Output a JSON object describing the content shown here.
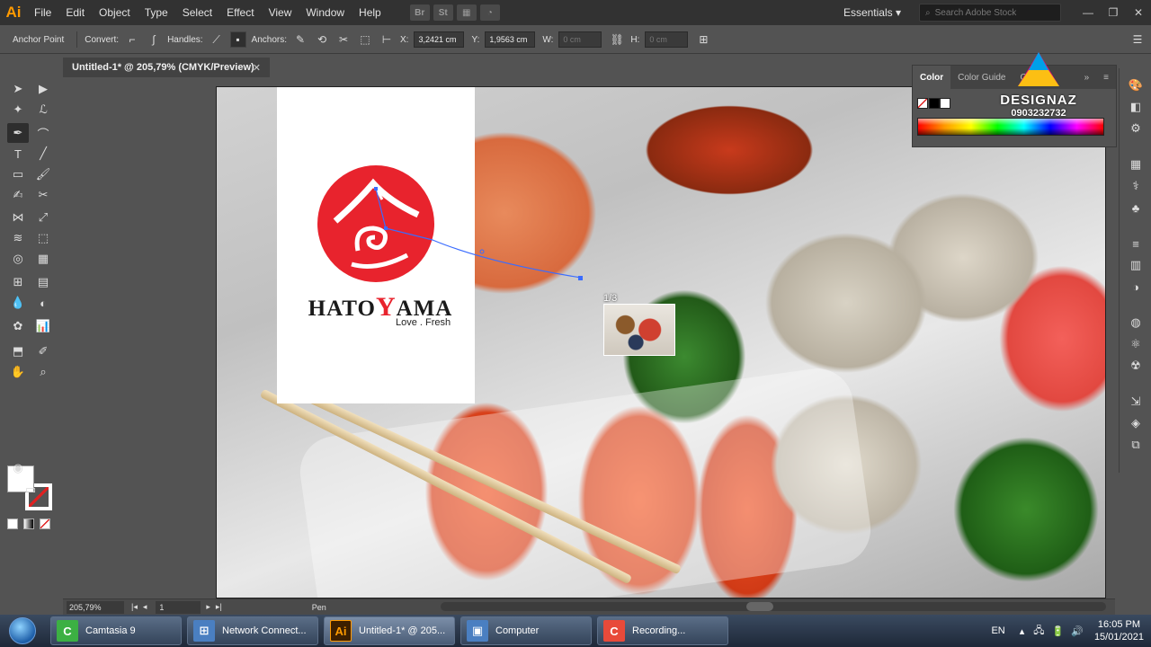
{
  "app": {
    "logo": "Ai",
    "workspace": "Essentials",
    "stock_placeholder": "Search Adobe Stock"
  },
  "menu": [
    "File",
    "Edit",
    "Object",
    "Type",
    "Select",
    "Effect",
    "View",
    "Window",
    "Help"
  ],
  "menu_icons": [
    {
      "name": "bridge-icon",
      "glyph": "Br"
    },
    {
      "name": "stock-icon",
      "glyph": "St"
    },
    {
      "name": "arrange-icon",
      "glyph": "▦"
    },
    {
      "name": "gpu-icon",
      "glyph": "◔"
    }
  ],
  "control": {
    "anchor_point": "Anchor Point",
    "convert": "Convert:",
    "handles": "Handles:",
    "anchors": "Anchors:",
    "x_label": "X:",
    "x_value": "3,2421 cm",
    "y_label": "Y:",
    "y_value": "1,9563 cm",
    "w_label": "W:",
    "w_value": "0 cm",
    "h_label": "H:",
    "h_value": "0 cm"
  },
  "document": {
    "tab_title": "Untitled-1* @ 205,79% (CMYK/Preview)",
    "close": "✕"
  },
  "logo": {
    "brand_pre": "HATO",
    "brand_y": "Y",
    "brand_post": "AMA",
    "tagline": "Love . Fresh"
  },
  "place_counter": "1/3",
  "color_panel": {
    "tabs": [
      "Color",
      "Color Guide",
      "C"
    ],
    "menu": "≡"
  },
  "watermark": {
    "brand": "DESIGNAZ",
    "phone": "0903232732"
  },
  "status": {
    "zoom": "205,79%",
    "page": "1",
    "tool": "Pen"
  },
  "taskbar": {
    "tasks": [
      {
        "label": "Camtasia 9",
        "icon": "C",
        "color": "#3cb043"
      },
      {
        "label": "Network Connect...",
        "icon": "⊞",
        "color": "#4a7fc1"
      },
      {
        "label": "Untitled-1* @ 205...",
        "icon": "Ai",
        "color": "#3d1f00"
      },
      {
        "label": "Computer",
        "icon": "▣",
        "color": "#4a7fc1"
      },
      {
        "label": "Recording...",
        "icon": "C",
        "color": "#e84a3a"
      }
    ],
    "language": "EN",
    "time": "16:05 PM",
    "date": "15/01/2021"
  },
  "colors": {
    "accent_ai": "#ff9a00",
    "logo_red": "#e8232d"
  }
}
